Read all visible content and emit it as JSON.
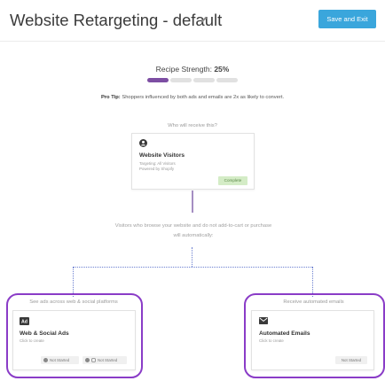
{
  "header": {
    "title": "Website Retargeting - default",
    "save_label": "Save and Exit"
  },
  "recipe": {
    "label": "Recipe Strength: ",
    "percent": "25%",
    "level": 0.25,
    "segments": 4,
    "accent": "#7d4ea3"
  },
  "protip": {
    "label": "Pro Tip:",
    "text": " Shoppers influenced by both ads and emails are 2x as likely to convert."
  },
  "audience": {
    "heading": "Who will receive this?",
    "card": {
      "icon": "user-icon",
      "title": "Website Visitors",
      "line1": "Targeting: All Visitors",
      "line2": "Powered by Shopify",
      "status": "Complete"
    }
  },
  "description": "Visitors who browse your website and do not add-to-cart or purchase will automatically:",
  "ads": {
    "heading": "See ads across web & social platforms",
    "icon": "ad-icon",
    "title": "Web & Social Ads",
    "subtitle": "Click to create",
    "badge1": "Not Started",
    "badge2": "Not Started"
  },
  "emails": {
    "heading": "Receive automated emails",
    "icon": "envelope-icon",
    "title": "Automated Emails",
    "subtitle": "Click to create",
    "badge": "Not Started"
  },
  "colors": {
    "primary_button": "#3aa6dc",
    "highlight": "#8a3cc7",
    "connector": "#6b7fd0"
  }
}
